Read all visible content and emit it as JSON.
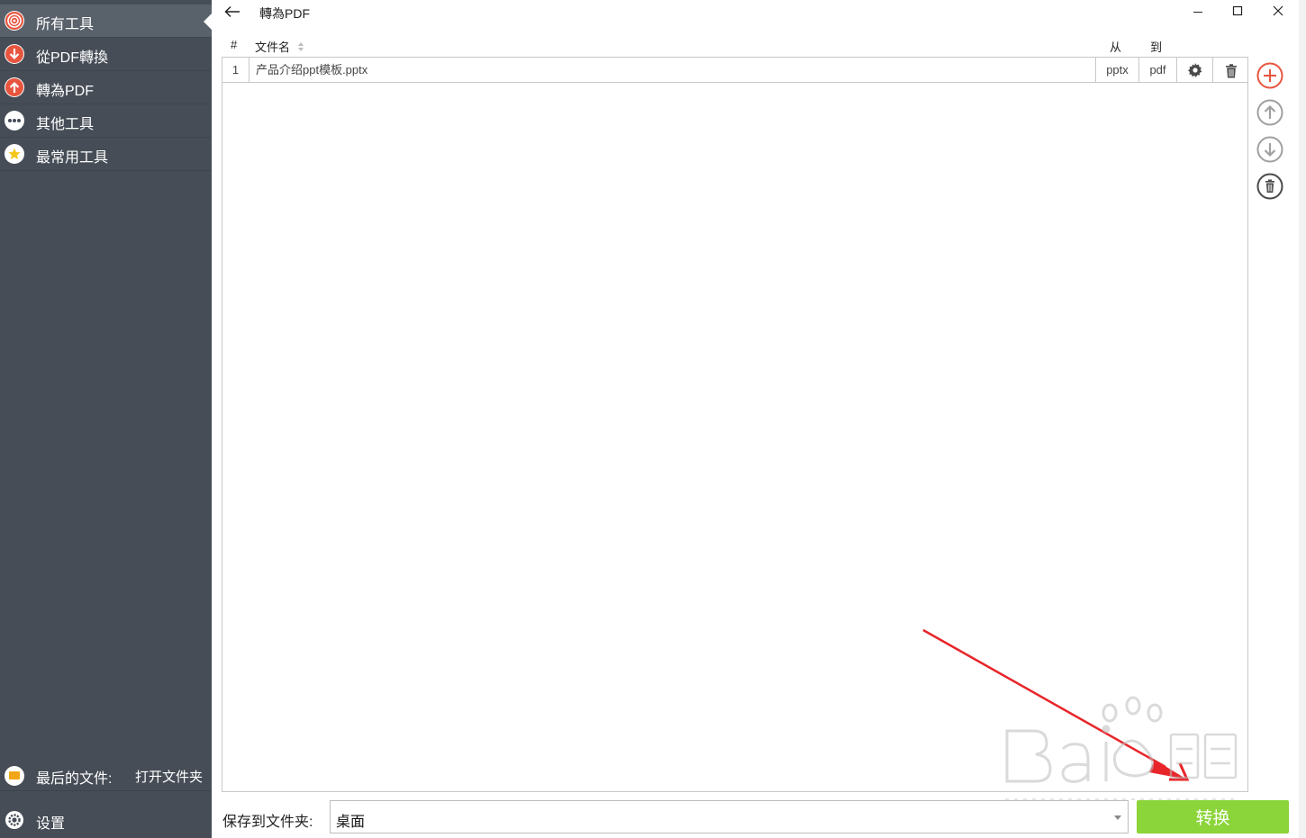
{
  "sidebar": {
    "items": [
      {
        "label": "所有工具",
        "icon": "target-icon",
        "active": true
      },
      {
        "label": "從PDF轉換",
        "icon": "arrow-down-icon",
        "active": false
      },
      {
        "label": "轉為PDF",
        "icon": "arrow-up-icon",
        "active": false
      },
      {
        "label": "其他工具",
        "icon": "ellipsis-icon",
        "active": false
      },
      {
        "label": "最常用工具",
        "icon": "star-icon",
        "active": false
      }
    ],
    "recent_label": "最后的文件:",
    "open_folder_label": "打开文件夹",
    "settings_label": "设置"
  },
  "titlebar": {
    "title": "轉為PDF",
    "back_icon": "back-arrow-icon",
    "controls": [
      "minimize-icon",
      "maximize-icon",
      "close-icon"
    ]
  },
  "table": {
    "headers": {
      "index": "#",
      "filename": "文件名",
      "from": "从",
      "to": "到"
    },
    "rows": [
      {
        "index": "1",
        "filename": "产品介绍ppt模板.pptx",
        "from": "pptx",
        "to": "pdf"
      }
    ]
  },
  "side_actions": [
    "add-icon",
    "move-up-icon",
    "move-down-icon",
    "delete-all-icon"
  ],
  "footer": {
    "save_label": "保存到文件夹:",
    "save_value": "桌面",
    "convert_label": "转换"
  },
  "colors": {
    "sidebar_bg": "#464d57",
    "sidebar_active": "#59616b",
    "accent_red": "#e8553f",
    "convert_green": "#8bd43a",
    "annotation_arrow": "#e8252a"
  }
}
